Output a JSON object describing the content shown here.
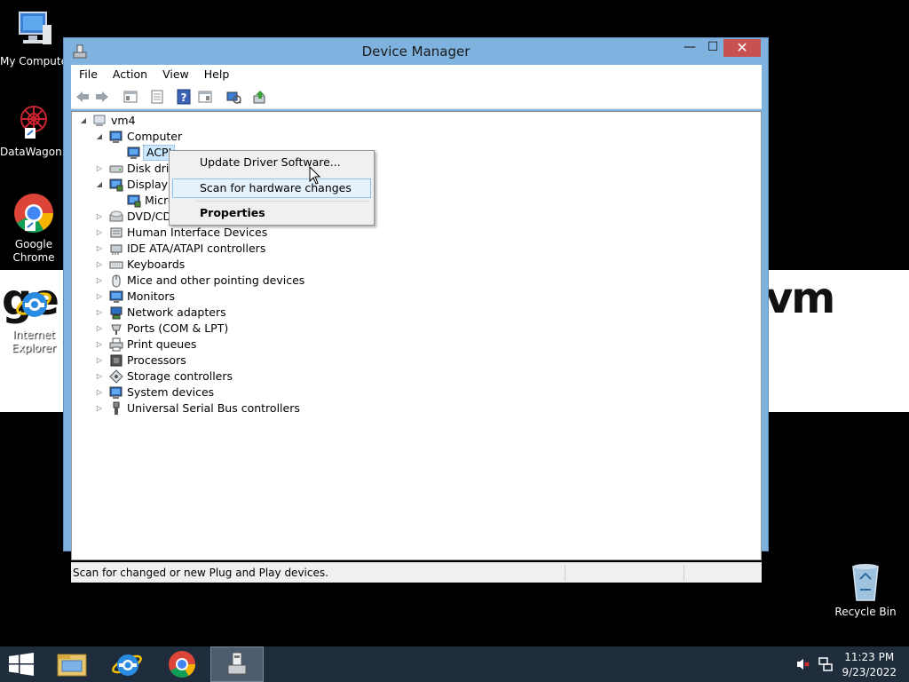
{
  "desktop": {
    "icons": [
      {
        "label": "My Compute"
      },
      {
        "label": "DataWagon..."
      },
      {
        "label": "Google\nChrome"
      },
      {
        "label": "Internet\nExplorer"
      },
      {
        "label": "Recycle Bin"
      }
    ],
    "wallpaper_left": "ge",
    "wallpaper_right": "vm"
  },
  "window": {
    "title": "Device Manager",
    "controls": {
      "minimize": "—",
      "maximize": "☐",
      "close": "✕"
    },
    "menu": [
      "File",
      "Action",
      "View",
      "Help"
    ]
  },
  "tree": {
    "root": "vm4",
    "computer": "Computer",
    "acpi": "ACPI",
    "disk": "Disk drive",
    "display": "Display a",
    "micro": "Micro",
    "dvd": "DVD/CD-",
    "categories": [
      "Human Interface Devices",
      "IDE ATA/ATAPI controllers",
      "Keyboards",
      "Mice and other pointing devices",
      "Monitors",
      "Network adapters",
      "Ports (COM & LPT)",
      "Print queues",
      "Processors",
      "Storage controllers",
      "System devices",
      "Universal Serial Bus controllers"
    ]
  },
  "context_menu": {
    "items": [
      "Update Driver Software...",
      "Scan for hardware changes",
      "Properties"
    ],
    "highlighted": "Scan for hardware changes"
  },
  "status": {
    "text": "Scan for changed or new Plug and Play devices."
  },
  "taskbar": {
    "time": "11:23 PM",
    "date": "9/23/2022"
  },
  "colors": {
    "window_frame": "#7fb2de",
    "close_button": "#c75050",
    "taskbar": "#1f2c3c",
    "menu_highlight": "#e5f1fb"
  }
}
